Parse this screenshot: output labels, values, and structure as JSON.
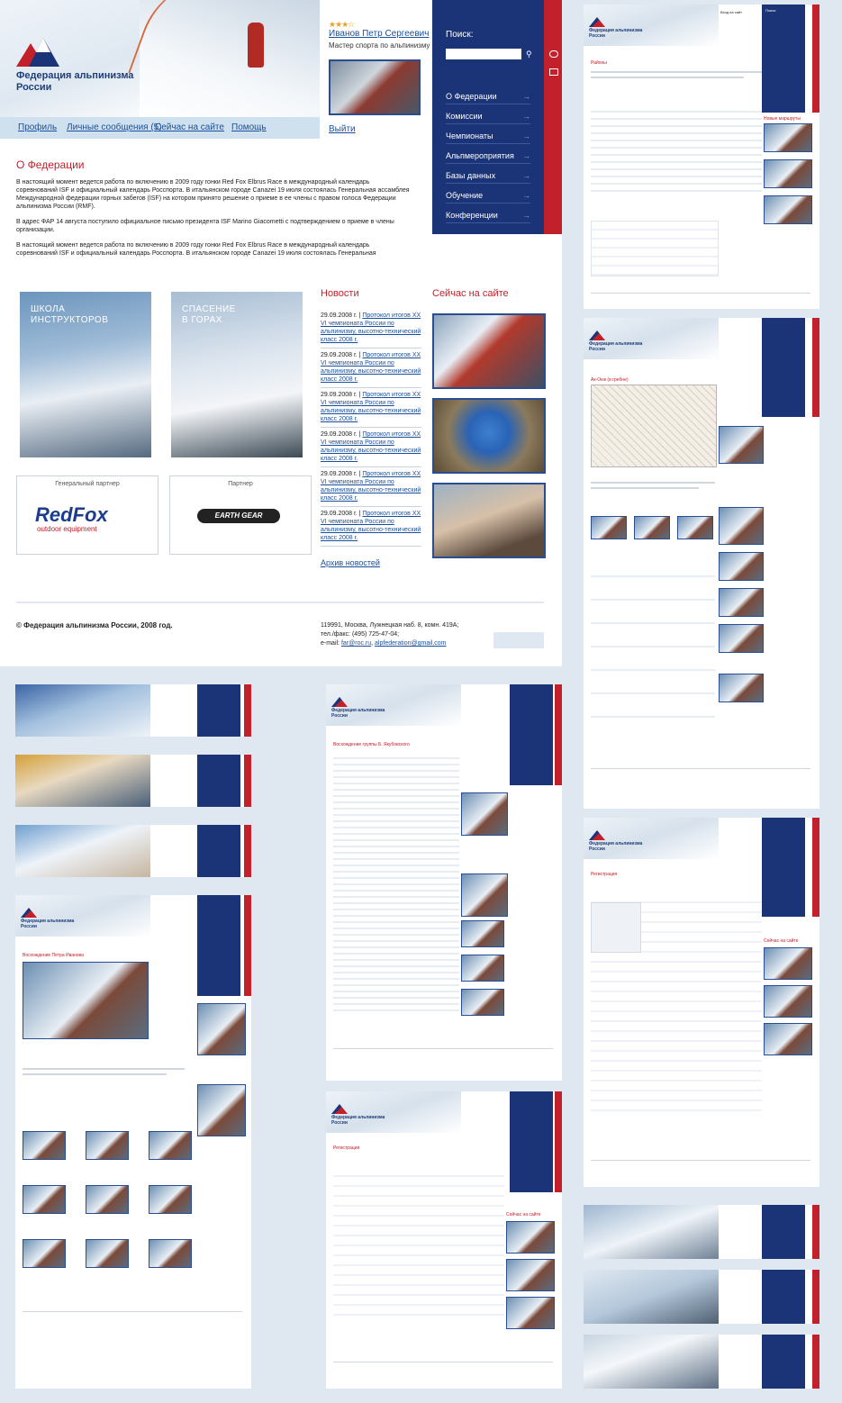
{
  "header": {
    "logo_line1": "Федерация альпинизма",
    "logo_line2": "России",
    "subnav": [
      {
        "label": "Профиль"
      },
      {
        "label": "Личные сообщения (5)"
      },
      {
        "label": "Сейчас на сайте"
      },
      {
        "label": "Помощь"
      }
    ]
  },
  "user": {
    "stars": "★★★☆",
    "name": "Иванов Петр Сергеевич",
    "rank": "Мастер спорта по альпинизму",
    "logout": "Выйти"
  },
  "nav": {
    "search_label": "Поиск:",
    "search_icon": "search-icon",
    "items": [
      {
        "label": "О Федерации"
      },
      {
        "label": "Комиссии"
      },
      {
        "label": "Чемпионаты"
      },
      {
        "label": "Альпмероприятия"
      },
      {
        "label": "Базы данных"
      },
      {
        "label": "Обучение"
      },
      {
        "label": "Конференции"
      }
    ],
    "arrow": "→"
  },
  "content": {
    "title": "О Федерации",
    "paragraphs": [
      "В настоящий момент ведется работа по включению в 2009 году гонки Red Fox Elbrus Race в международный календарь соревнований ISF и официальный календарь Росспорта. В итальянском городе Canazei 19 июля состоялась Генеральная ассамблея Международной федерации горных забегов (ISF) на котором принято решение о приеме в ее члены с правом голоса Федерации альпинизма России (RMF).",
      "В адрес ФАР 14 августа поступило официальное письмо президента ISF Marino Giacometti с подтверждением о приеме в члены организации.",
      "В настоящий момент ведется работа по включению в 2009 году гонки Red Fox Elbrus Race в международный календарь соревнований ISF и официальный календарь Росспорта. В итальянском городе Canazei 19 июля состоялась Генеральная"
    ]
  },
  "promos": [
    {
      "title_line1": "ШКОЛА",
      "title_line2": "ИНСТРУКТОРОВ"
    },
    {
      "title_line1": "СПАСЕНИЕ",
      "title_line2": "В ГОРАХ"
    }
  ],
  "partners": {
    "general_label": "Генеральный партнер",
    "general_brand": "RedFox",
    "general_brand_sub": "outdoor equipment",
    "partner_label": "Партнер",
    "partner_brand": "EARTH GEAR"
  },
  "news": {
    "title": "Новости",
    "items": [
      {
        "date": "29.09.2008 г.",
        "text": "Протокол итогов XX VI чемпионата России по альпинизму, высотно-технический класс 2008 г."
      },
      {
        "date": "29.09.2008 г.",
        "text": "Протокол итогов XX VI чемпионата России по альпинизму, высотно-технический класс 2008 г."
      },
      {
        "date": "29.09.2008 г.",
        "text": "Протокол итогов XX VI чемпионата России по альпинизму, высотно-технический класс 2008 г."
      },
      {
        "date": "29.09.2008 г.",
        "text": "Протокол итогов XX VI чемпионата России по альпинизму, высотно-технический класс 2008 г."
      },
      {
        "date": "29.09.2008 г.",
        "text": "Протокол итогов XX VI чемпионата России по альпинизму, высотно-технический класс 2008 г."
      },
      {
        "date": "29.09.2008 г.",
        "text": "Протокол итогов XX VI чемпионата России по альпинизму, высотно-технический класс 2008 г."
      }
    ],
    "archive": "Архив новостей"
  },
  "online": {
    "title": "Сейчас на сайте"
  },
  "footer": {
    "copyright": "© Федерация альпинизма России, 2008 год.",
    "address": "119991, Москва, Лужнецкая наб. 8, комн. 419А;",
    "phone": "тел./факс: (495) 725-47-04;",
    "email_label": "e-mail:",
    "email1": "far@roc.ru",
    "email2": "alpfederation@gmail.com"
  },
  "thumbs": {
    "regions_title": "Районы",
    "route_title": "Ак-Оюк (в гребне)",
    "ascent_title": "Восхождение группы Б. Якубовского",
    "climb_title": "Восхождение Петра Иванова",
    "registration_title": "Регистрация",
    "login_label": "Вход на сайт",
    "new_routes": "Новые маршруты",
    "now_online": "Сейчас на сайте",
    "search_label": "Поиск:"
  }
}
